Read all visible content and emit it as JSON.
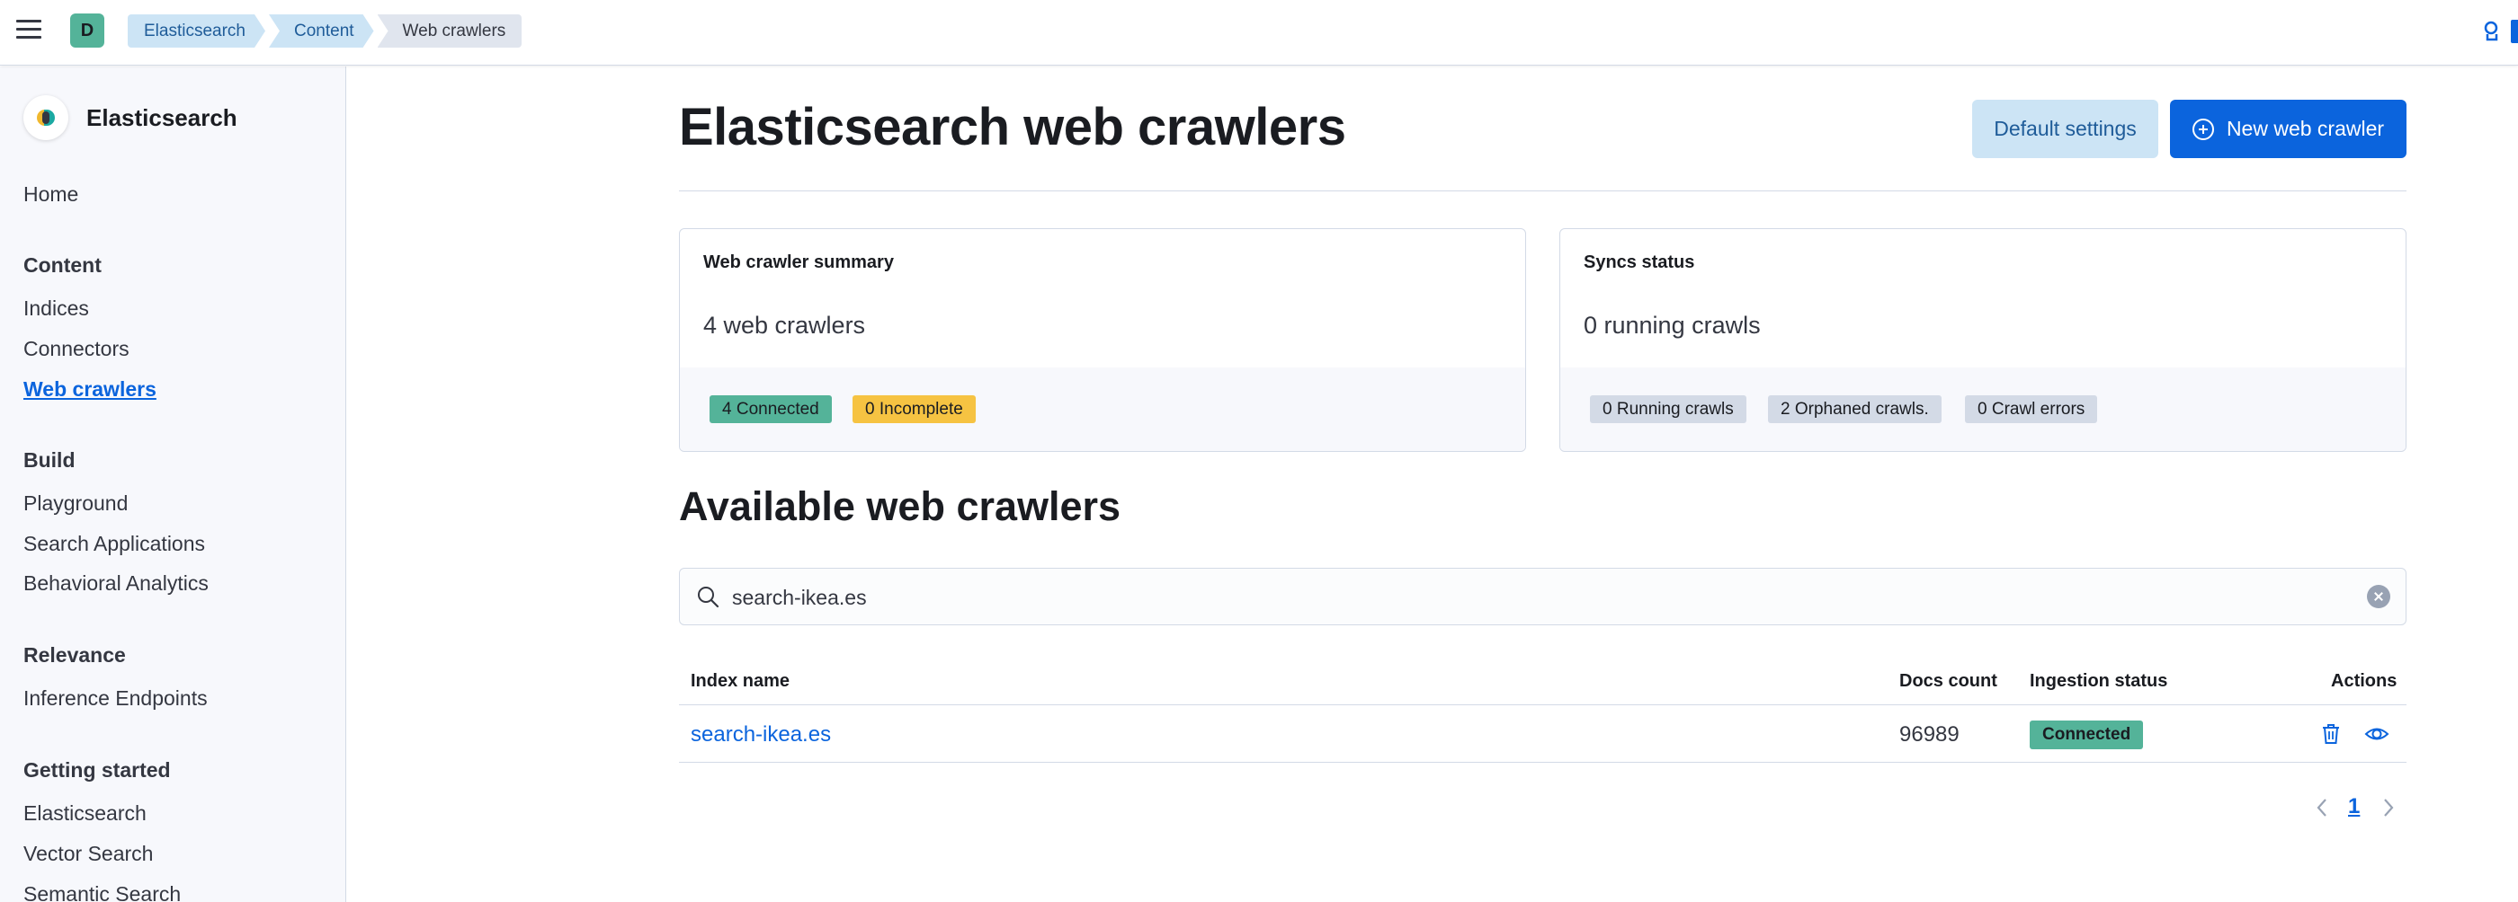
{
  "header": {
    "space_initial": "D",
    "breadcrumbs": [
      "Elasticsearch",
      "Content",
      "Web crawlers"
    ]
  },
  "sidebar": {
    "brand": "Elasticsearch",
    "home": "Home",
    "sections": [
      {
        "title": "Content",
        "items": [
          "Indices",
          "Connectors",
          "Web crawlers"
        ]
      },
      {
        "title": "Build",
        "items": [
          "Playground",
          "Search Applications",
          "Behavioral Analytics"
        ]
      },
      {
        "title": "Relevance",
        "items": [
          "Inference Endpoints"
        ]
      },
      {
        "title": "Getting started",
        "items": [
          "Elasticsearch",
          "Vector Search",
          "Semantic Search"
        ]
      }
    ],
    "active_item": "Web crawlers"
  },
  "page": {
    "title": "Elasticsearch web crawlers",
    "default_settings_label": "Default settings",
    "new_crawler_label": "New web crawler"
  },
  "summary": {
    "title": "Web crawler summary",
    "value": "4 web crawlers",
    "badges": [
      {
        "label": "4 Connected",
        "color": "#54b399"
      },
      {
        "label": "0 Incomplete",
        "color": "#f6c342"
      }
    ]
  },
  "syncs": {
    "title": "Syncs status",
    "value": "0 running crawls",
    "badges": [
      {
        "label": "0 Running crawls",
        "color": "#d3dae6"
      },
      {
        "label": "2 Orphaned crawls.",
        "color": "#d3dae6"
      },
      {
        "label": "0 Crawl errors",
        "color": "#d3dae6"
      }
    ]
  },
  "available": {
    "title": "Available web crawlers",
    "search_value": "search-ikea.es",
    "columns": [
      "Index name",
      "Docs count",
      "Ingestion status",
      "Actions"
    ],
    "rows": [
      {
        "index_name": "search-ikea.es",
        "docs_count": "96989",
        "status": "Connected"
      }
    ],
    "pagination": {
      "current": "1"
    }
  }
}
